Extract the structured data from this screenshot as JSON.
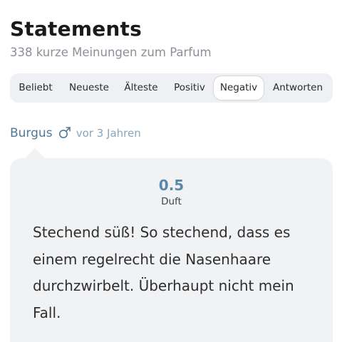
{
  "header": {
    "title": "Statements",
    "subtitle": "338 kurze Meinungen zum Parfum"
  },
  "tabs": [
    {
      "label": "Beliebt",
      "active": false
    },
    {
      "label": "Neueste",
      "active": false
    },
    {
      "label": "Älteste",
      "active": false
    },
    {
      "label": "Positiv",
      "active": false
    },
    {
      "label": "Negativ",
      "active": true
    },
    {
      "label": "Antworten",
      "active": false
    }
  ],
  "statement": {
    "author": "Burgus",
    "gender_icon": "male-symbol-icon",
    "time": "vor 3 Jahren",
    "rating": "0.5",
    "rating_label": "Duft",
    "text": "Stechend süß! So stechend, dass es einem regelrecht die Nasenhaare durchzwirbelt. Überhaupt nicht mein Fall."
  },
  "colors": {
    "accent": "#4e7a9a",
    "rating": "#5a88ab",
    "card_bg": "#f1f2f4",
    "tabs_bg": "#eef0f3"
  }
}
